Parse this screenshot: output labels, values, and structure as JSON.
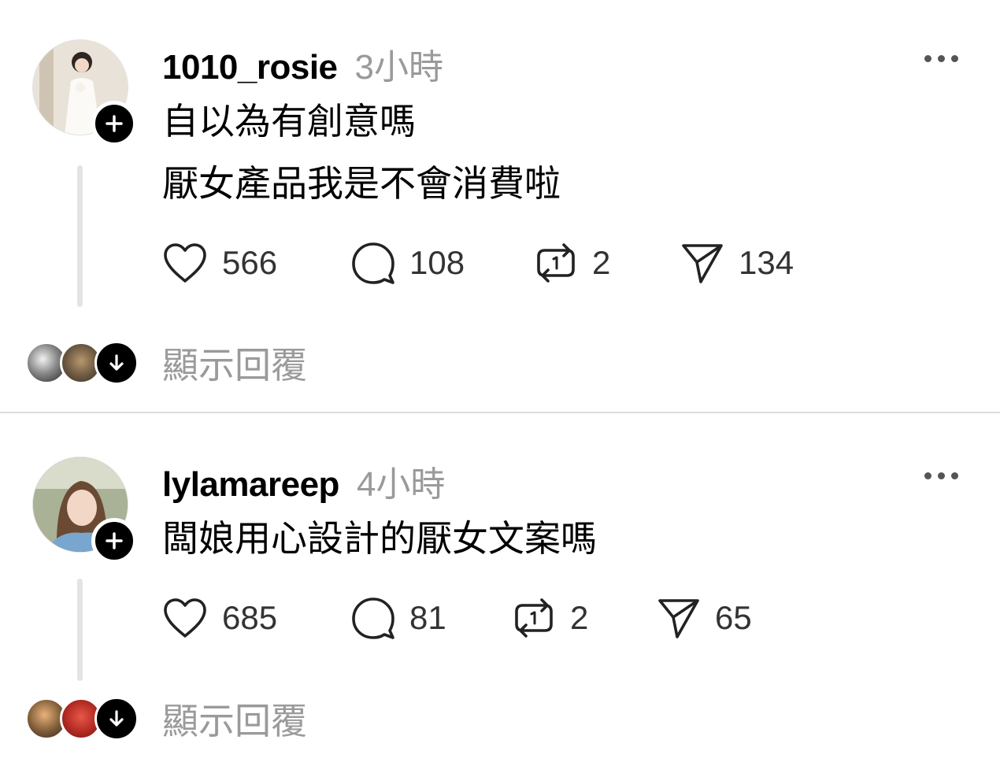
{
  "posts": [
    {
      "username": "1010_rosie",
      "time": "3小時",
      "lines": [
        "自以為有創意嗎",
        "厭女產品我是不會消費啦"
      ],
      "likes": "566",
      "comments": "108",
      "reposts": "2",
      "shares": "134",
      "show_replies": "顯示回覆"
    },
    {
      "username": "lylamareep",
      "time": "4小時",
      "lines": [
        "闆娘用心設計的厭女文案嗎"
      ],
      "likes": "685",
      "comments": "81",
      "reposts": "2",
      "shares": "65",
      "show_replies": "顯示回覆"
    }
  ],
  "icons": {
    "more": "more-options-icon",
    "like": "heart-icon",
    "comment": "comment-bubble-icon",
    "repost": "repost-icon",
    "share": "send-icon",
    "follow": "plus-icon",
    "expand": "arrow-down-icon"
  }
}
